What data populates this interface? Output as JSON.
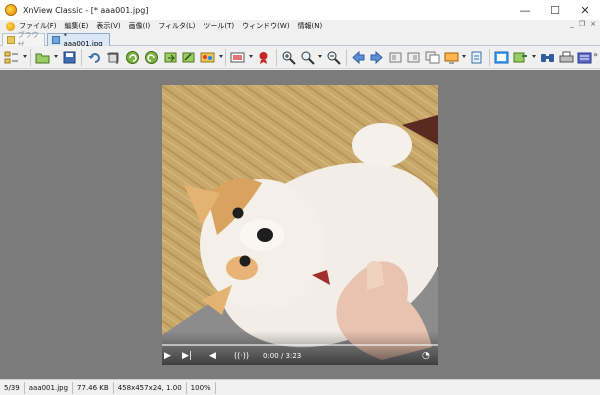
{
  "window": {
    "title": "XnView Classic - [* aaa001.jpg]",
    "minimize_glyph": "—",
    "maximize_glyph": "☐",
    "close_glyph": "✕"
  },
  "menu": {
    "items": [
      "ファイル(F)",
      "編集(E)",
      "表示(V)",
      "画像(I)",
      "フィルタ(L)",
      "ツール(T)",
      "ウィンドウ(W)",
      "情報(N)"
    ],
    "mdi_minimize": "_",
    "mdi_restore": "❐",
    "mdi_close": "×"
  },
  "tabs": [
    {
      "label": "ブラウザ",
      "active": false
    },
    {
      "label": "* aaa001.jpg",
      "active": true
    }
  ],
  "toolbar": {
    "icons": [
      "browser-mode-icon",
      "open-folder-icon",
      "save-icon",
      "undo-icon",
      "crop-icon",
      "rotate-left-icon",
      "rotate-right-icon",
      "export-icon",
      "edit-icon",
      "color-adjust-icon",
      "slideshow-icon",
      "effects-icon",
      "zoom-in-icon",
      "zoom-menu-icon",
      "zoom-out-icon",
      "previous-icon",
      "next-icon",
      "first-page-icon",
      "last-page-icon",
      "copy-icon",
      "capture-icon",
      "settings-icon",
      "fullscreen-icon",
      "convert-icon",
      "find-icon",
      "print-icon",
      "scan-icon"
    ],
    "overflow_glyph": "»"
  },
  "video": {
    "time": "0:00 / 3:23",
    "progress": 0,
    "play_glyph": "▶",
    "volume_glyph": "◀",
    "cast_glyph": "((·))"
  },
  "status": {
    "index": "5/39",
    "filename": "aaa001.jpg",
    "filesize": "77.46 KB",
    "dimensions": "458x457x24, 1.00",
    "zoom": "100%"
  },
  "colors": {
    "viewer_bg": "#7b7b7b",
    "titlebar_bg": "#ffffff",
    "chrome_bg": "#f0f0f0",
    "active_tab": "#dbe8f8"
  }
}
